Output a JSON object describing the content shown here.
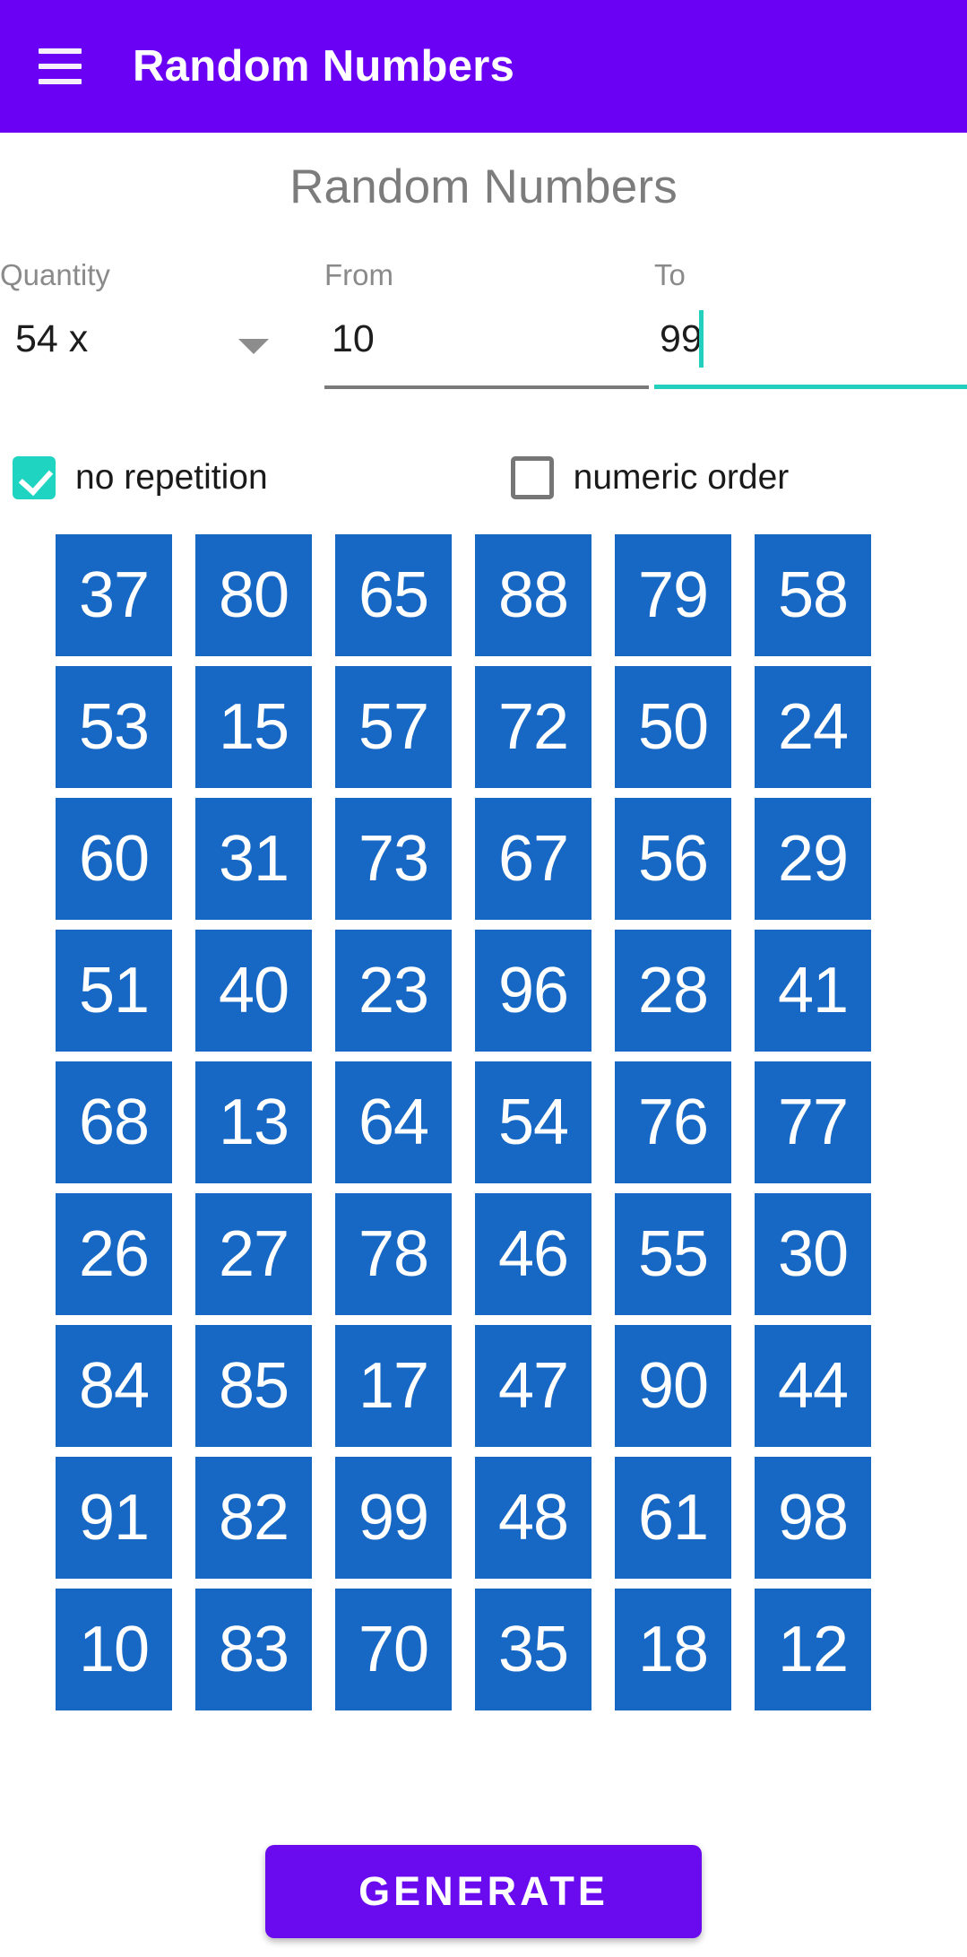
{
  "appbar": {
    "menu_icon": "hamburger-menu-icon",
    "title": "Random Numbers",
    "background_color": "#6A00F4"
  },
  "page": {
    "heading": "Random Numbers"
  },
  "form": {
    "quantity": {
      "label": "Quantity",
      "value": "54 x",
      "dropdown_icon": "chevron-down-icon"
    },
    "from": {
      "label": "From",
      "value": "10",
      "placeholder": "",
      "underline_color": "#7a7a7a"
    },
    "to": {
      "label": "To",
      "value": "99",
      "placeholder": "",
      "focused": true,
      "underline_color": "#23cfbd",
      "caret_color": "#23cfbd"
    }
  },
  "options": {
    "no_repetition": {
      "label": "no repetition",
      "checked": true,
      "check_color": "#1fd4c1"
    },
    "numeric_order": {
      "label": "numeric order",
      "checked": false,
      "box_color": "#767676"
    }
  },
  "results": {
    "tile_color": "#1668c4",
    "tile_text_color": "#ffffff",
    "columns": 6,
    "count": 54,
    "numbers": [
      "37",
      "80",
      "65",
      "88",
      "79",
      "58",
      "53",
      "15",
      "57",
      "72",
      "50",
      "24",
      "60",
      "31",
      "73",
      "67",
      "56",
      "29",
      "51",
      "40",
      "23",
      "96",
      "28",
      "41",
      "68",
      "13",
      "64",
      "54",
      "76",
      "77",
      "26",
      "27",
      "78",
      "46",
      "55",
      "30",
      "84",
      "85",
      "17",
      "47",
      "90",
      "44",
      "91",
      "82",
      "99",
      "48",
      "61",
      "98",
      "10",
      "83",
      "70",
      "35",
      "18",
      "12"
    ]
  },
  "actions": {
    "generate_label": "GENERATE",
    "generate_color": "#6A0BEF"
  }
}
